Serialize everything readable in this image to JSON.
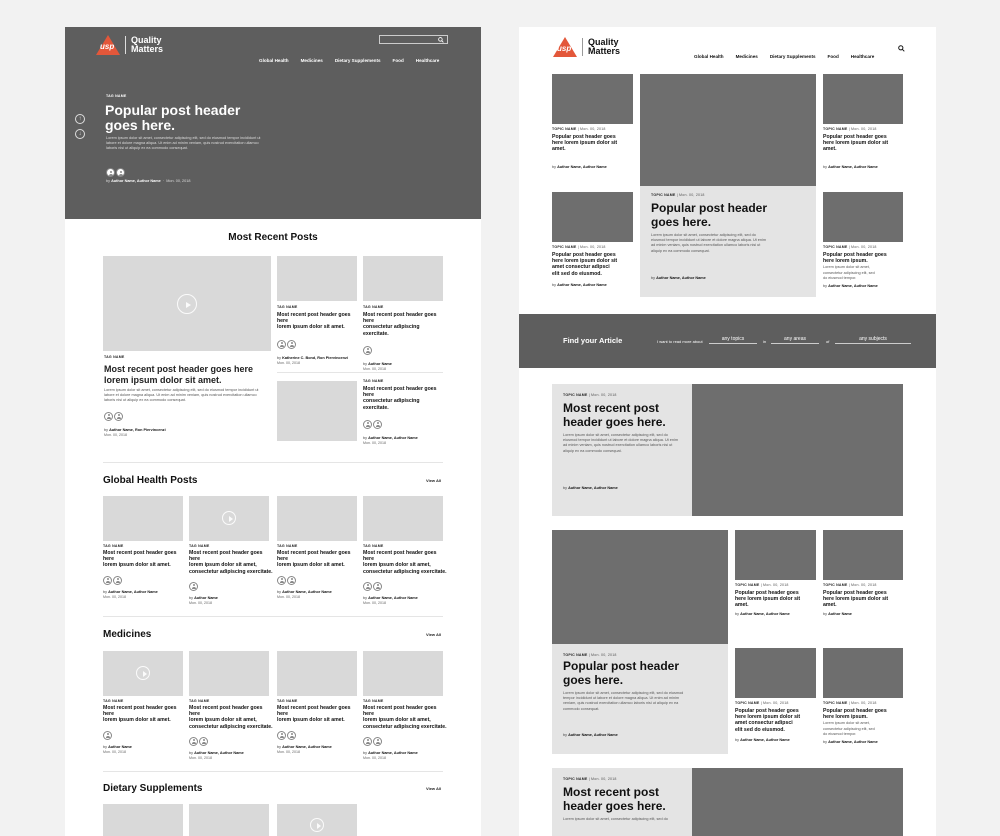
{
  "brand": {
    "mark": "usp",
    "name_line1": "Quality",
    "name_line2": "Matters",
    "accent": "#e3573a"
  },
  "left": {
    "nav": [
      "Global Health",
      "Medicines",
      "Dietary Supplements",
      "Food",
      "Healthcare"
    ],
    "hero": {
      "tag": "TAG NAME",
      "title_line1": "Popular post header",
      "title_line2": "goes here.",
      "body_line1": "Lorem ipsum dolor sit amet, consectetur adipiscing elit, sed do eiusmod tempor incididunt ut",
      "body_line2": "labore et dolore magna aliqua. Ut enim ad minim veniam, quis nostrud exercitation ullamco",
      "body_line3": "laboris nisi ut aliquip ex ea commodo consequat.",
      "by": "by",
      "author": "Author Name, Author Name",
      "date": "Mon. 00, 2018"
    },
    "recent": {
      "title": "Most Recent Posts",
      "big": {
        "tag": "TAG NAME",
        "title_line1": "Most recent post header goes here",
        "title_line2": "lorem ipsum dolor sit amet.",
        "body_line1": "Lorem ipsum dolor sit amet, consectetur adipiscing elit, sed do eiusmod tempor incididunt ut",
        "body_line2": "labore et dolore magna aliqua. Ut enim ad minim veniam, quis nostrud exercitation ullamco",
        "body_line3": "laboris nisi ut aliquip ex ea commodo consequat.",
        "by": "by",
        "author": "Author Name, Ron Piervincenzi",
        "date": "Mon. 00, 2018"
      },
      "cards": [
        {
          "tag": "TAG NAME",
          "line1": "Most recent post header goes here",
          "line2": "lorem ipsum dolor sit amet.",
          "by": "by",
          "author": "Katherine C. Bond, Ron Piervincenzi",
          "date": "Mon. 00, 2018"
        },
        {
          "tag": "TAG NAME",
          "line1": "Most recent post header goes here",
          "line2": "consectetur adipiscing exercitate.",
          "by": "by",
          "author": "Author Name",
          "date": "Mon. 00, 2018"
        },
        {
          "tag": "TAG NAME",
          "line1": "Most recent post header goes here",
          "line2": "consectetur adipiscing exercitate.",
          "by": "by",
          "author": "Author Name, Author Name",
          "date": "Mon. 00, 2018"
        }
      ]
    },
    "global": {
      "title": "Global Health Posts",
      "view_all": "View All",
      "cards": [
        {
          "tag": "TAG NAME",
          "line1": "Most recent post header goes here",
          "line2": "lorem ipsum dolor sit amet.",
          "line3": "",
          "by": "by",
          "author": "Author Name, Author Name",
          "date": "Mon. 00, 2018"
        },
        {
          "tag": "TAG NAME",
          "line1": "Most recent post header goes here",
          "line2": "lorem ipsum dolor sit amet,",
          "line3": "consectetur adipiscing exercitate.",
          "by": "by",
          "author": "Author Name",
          "date": "Mon. 00, 2018"
        },
        {
          "tag": "TAG NAME",
          "line1": "Most recent post header goes here",
          "line2": "lorem ipsum dolor sit amet.",
          "line3": "",
          "by": "by",
          "author": "Author Name, Author Name",
          "date": "Mon. 00, 2018"
        },
        {
          "tag": "TAG NAME",
          "line1": "Most recent post header goes here",
          "line2": "lorem ipsum dolor sit amet,",
          "line3": "consectetur adipiscing exercitate.",
          "by": "by",
          "author": "Author Name, Author Name",
          "date": "Mon. 00, 2018"
        }
      ]
    },
    "medicines": {
      "title": "Medicines",
      "view_all": "View All",
      "cards": [
        {
          "tag": "TAG NAME",
          "line1": "Most recent post header goes here",
          "line2": "lorem ipsum dolor sit amet.",
          "line3": "",
          "by": "by",
          "author": "Author Name",
          "date": "Mon. 00, 2018"
        },
        {
          "tag": "TAG NAME",
          "line1": "Most recent post header goes here",
          "line2": "lorem ipsum dolor sit amet,",
          "line3": "consectetur adipiscing exercitate.",
          "by": "by",
          "author": "Author Name, Author Name",
          "date": "Mon. 00, 2018"
        },
        {
          "tag": "TAG NAME",
          "line1": "Most recent post header goes here",
          "line2": "lorem ipsum dolor sit amet.",
          "line3": "",
          "by": "by",
          "author": "Author Name, Author Name",
          "date": "Mon. 00, 2018"
        },
        {
          "tag": "TAG NAME",
          "line1": "Most recent post header goes here",
          "line2": "lorem ipsum dolor sit amet,",
          "line3": "consectetur adipiscing exercitate.",
          "by": "by",
          "author": "Author Name, Author Name",
          "date": "Mon. 00, 2018"
        }
      ]
    },
    "dietary": {
      "title": "Dietary Supplements",
      "view_all": "View All"
    }
  },
  "right": {
    "nav": [
      "Global Health",
      "Medicines",
      "Dietary Supplements",
      "Food",
      "Healthcare"
    ],
    "top_cards": [
      {
        "tag": "TOPIC NAME",
        "date": "Mon. 00, 2018",
        "line1": "Popular post header goes",
        "line2": "here lorem ipsum dolor sit",
        "line3": "amet.",
        "line4": "",
        "by": "by",
        "author": "Author Name, Author Name"
      },
      {
        "tag": "TOPIC NAME",
        "date": "Mon. 00, 2018",
        "line1": "Popular post header goes",
        "line2": "here lorem ipsum dolor sit",
        "line3": "amet.",
        "line4": "",
        "by": "by",
        "author": "Author Name, Author Name"
      },
      {
        "tag": "TOPIC NAME",
        "date": "Mon. 00, 2018",
        "line1": "Popular post header goes",
        "line2": "here lorem ipsum dolor sit",
        "line3": "amet consectur adipsci",
        "line4": "elit sed do eiusmod.",
        "by": "by",
        "author": "Author Name, Author Name"
      },
      {
        "tag": "TOPIC NAME",
        "date": "Mon. 00, 2018",
        "line1": "Popular post header goes",
        "line2": "here lorem ipsum.",
        "line3": "",
        "line4": "",
        "by": "by",
        "author": "Author Name, Author Name"
      }
    ],
    "featured": {
      "tag": "TOPIC NAME",
      "date": "Mon. 00, 2018",
      "title_line1": "Popular post header",
      "title_line2": "goes here.",
      "body_line1": "Lorem ipsum dolor sit amet, consectetur adipiscing elit, sed do",
      "body_line2": "eiusmod tempor incididunt ut labore et dolore magna aliqua. Ut enim",
      "body_line3": "ad minim veniam, quis nostrud exercitation ullamco laboris nisi ut",
      "body_line4": "aliquip ex ea commodo consequat.",
      "by": "by",
      "author": "Author Name, Author Name"
    },
    "finder": {
      "title": "Find your Article",
      "prompt": "I want to read more about",
      "topics": "any topics",
      "in": "in",
      "areas": "any areas",
      "of": "of",
      "subjects": "any subjects"
    },
    "block1": {
      "tag": "TOPIC NAME",
      "date": "Mon. 00, 2018",
      "title_line1": "Most recent post",
      "title_line2": "header goes here.",
      "body_line1": "Lorem ipsum dolor sit amet, consectetur adipiscing elit, sed do",
      "body_line2": "eiusmod tempor incididunt ut labore et dolore magna aliqua. Ut enim",
      "body_line3": "ad minim veniam, quis nostrud exercitation ullamco laboris nisi ut",
      "body_line4": "aliquip ex ea commodo consequat.",
      "by": "by",
      "author": "Author Name, Author Name"
    },
    "block2": {
      "tag": "TOPIC NAME",
      "date": "Mon. 00, 2018",
      "title_line1": "Popular post header",
      "title_line2": "goes here.",
      "body_line1": "Lorem ipsum dolor sit amet, consectetur adipiscing elit, sed do eiusmod",
      "body_line2": "tempor incididunt ut labore et dolore magna aliqua. Ut enim ad minim",
      "body_line3": "veniam, quis nostrud exercitation ullamco laboris nisi ut aliquip ex ea",
      "body_line4": "commodo consequat.",
      "by": "by",
      "author": "Author Name, Author Name"
    },
    "grid_cards": [
      {
        "tag": "TOPIC NAME",
        "date": "Mon. 00, 2018",
        "line1": "Popular post header goes",
        "line2": "here lorem ipsum dolor sit",
        "line3": "amet.",
        "line4": "",
        "by": "by",
        "author": "Author Name, Author Name"
      },
      {
        "tag": "TOPIC NAME",
        "date": "Mon. 00, 2018",
        "line1": "Popular post header goes",
        "line2": "here lorem ipsum dolor sit",
        "line3": "amet.",
        "line4": "",
        "by": "by",
        "author": "Author Name"
      },
      {
        "tag": "TOPIC NAME",
        "date": "Mon. 00, 2018",
        "line1": "Popular post header goes",
        "line2": "here lorem ipsum dolor sit",
        "line3": "amet consectur adipsci",
        "line4": "elit sed do eiusmod.",
        "by": "by",
        "author": "Author Name, Author Name"
      },
      {
        "tag": "TOPIC NAME",
        "date": "Mon. 00, 2018",
        "line1": "Popular post header goes",
        "line2": "here lorem ipsum.",
        "line3": "",
        "line4": "",
        "by": "by",
        "author": "Author Name, Author Name"
      }
    ],
    "block3": {
      "tag": "TOPIC NAME",
      "date": "Mon. 00, 2018",
      "title_line1": "Most recent post",
      "title_line2": "header goes here.",
      "body_line1": "Lorem ipsum dolor sit amet, consectetur adipiscing elit, sed do"
    }
  }
}
